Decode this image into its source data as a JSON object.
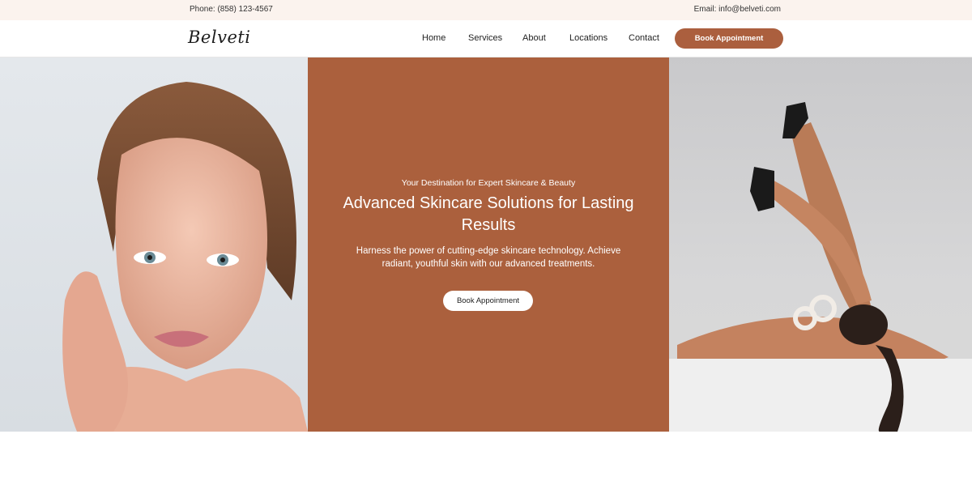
{
  "topbar": {
    "phone": "Phone: (858) 123-4567",
    "email": "Email: info@belveti.com"
  },
  "nav": {
    "logo": "Belveti",
    "items": [
      {
        "label": "Home"
      },
      {
        "label": "Services"
      },
      {
        "label": "About"
      },
      {
        "label": "Locations"
      },
      {
        "label": "Contact"
      }
    ],
    "cta_label": "Book Appointment"
  },
  "hero": {
    "eyebrow": "Your Destination for Expert Skincare & Beauty",
    "headline": "Advanced Skincare Solutions for Lasting Results",
    "subtext": "Harness the power of cutting-edge skincare technology. Achieve radiant, youthful skin with our advanced treatments.",
    "cta_label": "Book Appointment"
  },
  "colors": {
    "accent": "#ab5f3e",
    "topbar_bg": "#fbf3ee",
    "hero_panel": "#ab603d"
  }
}
